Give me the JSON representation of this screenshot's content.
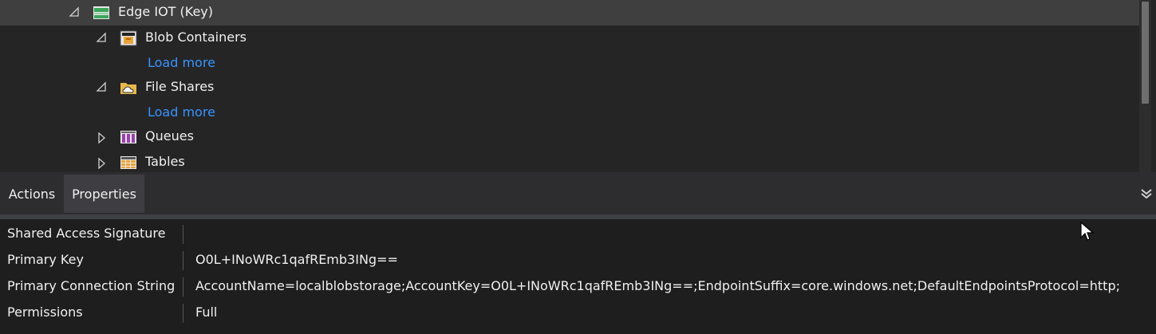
{
  "tree": {
    "items": [
      {
        "label": "Edge IOT (Key)",
        "expanded": true,
        "icon": "storage-account-icon"
      },
      {
        "label": "Blob Containers",
        "expanded": true,
        "icon": "blob-containers-icon"
      },
      {
        "load_more": "Load more"
      },
      {
        "label": "File Shares",
        "expanded": true,
        "icon": "file-shares-icon"
      },
      {
        "load_more": "Load more"
      },
      {
        "label": "Queues",
        "expanded": false,
        "icon": "queues-icon"
      },
      {
        "label": "Tables",
        "expanded": false,
        "icon": "tables-icon"
      }
    ]
  },
  "tabs": [
    {
      "label": "Actions",
      "active": false
    },
    {
      "label": "Properties",
      "active": true
    }
  ],
  "properties": [
    {
      "name": "Shared Access Signature",
      "value": ""
    },
    {
      "name": "Primary Key",
      "value": "O0L+INoWRc1qafREmb3INg=="
    },
    {
      "name": "Primary Connection String",
      "value": "AccountName=localblobstorage;AccountKey=O0L+INoWRc1qafREmb3INg==;EndpointSuffix=core.windows.net;DefaultEndpointsProtocol=http;"
    },
    {
      "name": "Permissions",
      "value": "Full"
    }
  ],
  "colors": {
    "background": "#252526",
    "selected_row": "#3f3f40",
    "link": "#3794ff",
    "text": "#f0f0f0"
  }
}
